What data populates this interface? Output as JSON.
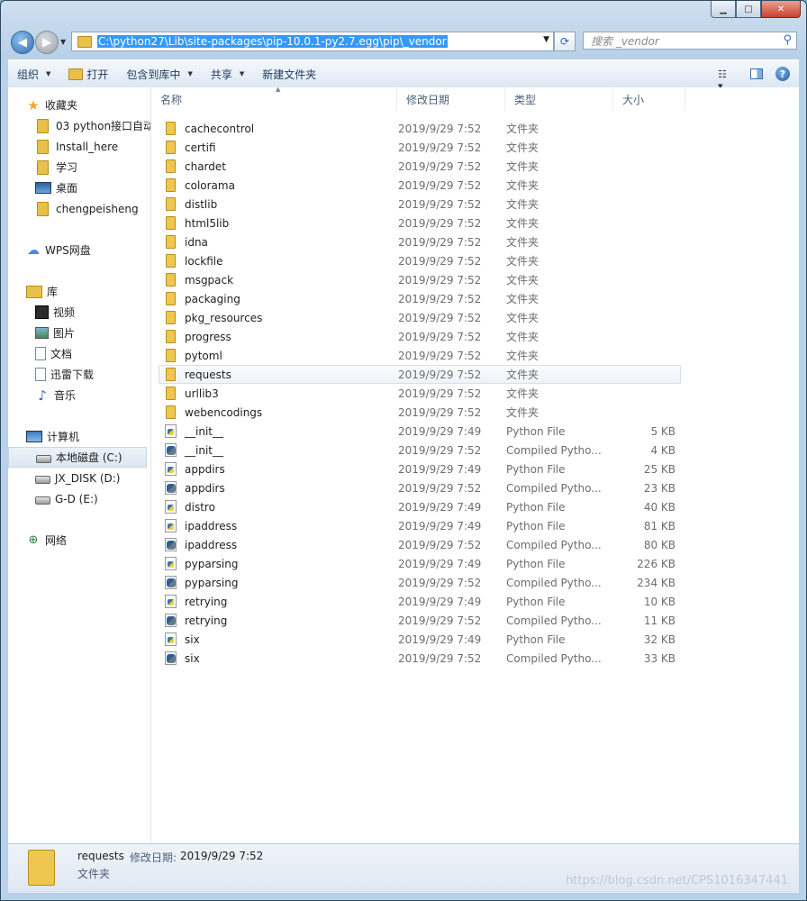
{
  "window": {
    "caption_buttons": {
      "minimize": "▁",
      "maximize": "□",
      "close": "✕"
    }
  },
  "address_bar": {
    "path": "C:\\python27\\Lib\\site-packages\\pip-10.0.1-py2.7.egg\\pip\\_vendor",
    "search_placeholder": "搜索 _vendor"
  },
  "toolbar": {
    "organize": "组织",
    "open": "打开",
    "include_in_library": "包含到库中",
    "share": "共享",
    "new_folder": "新建文件夹"
  },
  "nav": {
    "favorites": {
      "label": "收藏夹",
      "items": [
        "03 python接口自动",
        "Install_here",
        "学习",
        "桌面",
        "chengpeisheng"
      ]
    },
    "wps": {
      "label": "WPS网盘"
    },
    "libraries": {
      "label": "库",
      "items": [
        "视频",
        "图片",
        "文档",
        "迅雷下载",
        "音乐"
      ]
    },
    "computer": {
      "label": "计算机",
      "items": [
        "本地磁盘 (C:)",
        "JX_DISK (D:)",
        "G-D (E:)"
      ]
    },
    "network": {
      "label": "网络"
    }
  },
  "columns": {
    "name": "名称",
    "date": "修改日期",
    "type": "类型",
    "size": "大小"
  },
  "files": [
    {
      "name": "cachecontrol",
      "date": "2019/9/29 7:52",
      "type": "文件夹",
      "size": "",
      "kind": "folder"
    },
    {
      "name": "certifi",
      "date": "2019/9/29 7:52",
      "type": "文件夹",
      "size": "",
      "kind": "folder"
    },
    {
      "name": "chardet",
      "date": "2019/9/29 7:52",
      "type": "文件夹",
      "size": "",
      "kind": "folder"
    },
    {
      "name": "colorama",
      "date": "2019/9/29 7:52",
      "type": "文件夹",
      "size": "",
      "kind": "folder"
    },
    {
      "name": "distlib",
      "date": "2019/9/29 7:52",
      "type": "文件夹",
      "size": "",
      "kind": "folder"
    },
    {
      "name": "html5lib",
      "date": "2019/9/29 7:52",
      "type": "文件夹",
      "size": "",
      "kind": "folder"
    },
    {
      "name": "idna",
      "date": "2019/9/29 7:52",
      "type": "文件夹",
      "size": "",
      "kind": "folder"
    },
    {
      "name": "lockfile",
      "date": "2019/9/29 7:52",
      "type": "文件夹",
      "size": "",
      "kind": "folder"
    },
    {
      "name": "msgpack",
      "date": "2019/9/29 7:52",
      "type": "文件夹",
      "size": "",
      "kind": "folder"
    },
    {
      "name": "packaging",
      "date": "2019/9/29 7:52",
      "type": "文件夹",
      "size": "",
      "kind": "folder"
    },
    {
      "name": "pkg_resources",
      "date": "2019/9/29 7:52",
      "type": "文件夹",
      "size": "",
      "kind": "folder"
    },
    {
      "name": "progress",
      "date": "2019/9/29 7:52",
      "type": "文件夹",
      "size": "",
      "kind": "folder"
    },
    {
      "name": "pytoml",
      "date": "2019/9/29 7:52",
      "type": "文件夹",
      "size": "",
      "kind": "folder"
    },
    {
      "name": "requests",
      "date": "2019/9/29 7:52",
      "type": "文件夹",
      "size": "",
      "kind": "folder",
      "hover": true
    },
    {
      "name": "urllib3",
      "date": "2019/9/29 7:52",
      "type": "文件夹",
      "size": "",
      "kind": "folder"
    },
    {
      "name": "webencodings",
      "date": "2019/9/29 7:52",
      "type": "文件夹",
      "size": "",
      "kind": "folder"
    },
    {
      "name": "__init__",
      "date": "2019/9/29 7:49",
      "type": "Python File",
      "size": "5 KB",
      "kind": "py"
    },
    {
      "name": "__init__",
      "date": "2019/9/29 7:52",
      "type": "Compiled Pytho...",
      "size": "4 KB",
      "kind": "pyc"
    },
    {
      "name": "appdirs",
      "date": "2019/9/29 7:49",
      "type": "Python File",
      "size": "25 KB",
      "kind": "py"
    },
    {
      "name": "appdirs",
      "date": "2019/9/29 7:52",
      "type": "Compiled Pytho...",
      "size": "23 KB",
      "kind": "pyc"
    },
    {
      "name": "distro",
      "date": "2019/9/29 7:49",
      "type": "Python File",
      "size": "40 KB",
      "kind": "py"
    },
    {
      "name": "ipaddress",
      "date": "2019/9/29 7:49",
      "type": "Python File",
      "size": "81 KB",
      "kind": "py"
    },
    {
      "name": "ipaddress",
      "date": "2019/9/29 7:52",
      "type": "Compiled Pytho...",
      "size": "80 KB",
      "kind": "pyc"
    },
    {
      "name": "pyparsing",
      "date": "2019/9/29 7:49",
      "type": "Python File",
      "size": "226 KB",
      "kind": "py"
    },
    {
      "name": "pyparsing",
      "date": "2019/9/29 7:52",
      "type": "Compiled Pytho...",
      "size": "234 KB",
      "kind": "pyc"
    },
    {
      "name": "retrying",
      "date": "2019/9/29 7:49",
      "type": "Python File",
      "size": "10 KB",
      "kind": "py"
    },
    {
      "name": "retrying",
      "date": "2019/9/29 7:52",
      "type": "Compiled Pytho...",
      "size": "11 KB",
      "kind": "pyc"
    },
    {
      "name": "six",
      "date": "2019/9/29 7:49",
      "type": "Python File",
      "size": "32 KB",
      "kind": "py"
    },
    {
      "name": "six",
      "date": "2019/9/29 7:52",
      "type": "Compiled Pytho...",
      "size": "33 KB",
      "kind": "pyc"
    }
  ],
  "details": {
    "name": "requests",
    "modified_label": "修改日期:",
    "modified_value": "2019/9/29 7:52",
    "type": "文件夹"
  },
  "watermark": "https://blog.csdn.net/CPS1016347441"
}
